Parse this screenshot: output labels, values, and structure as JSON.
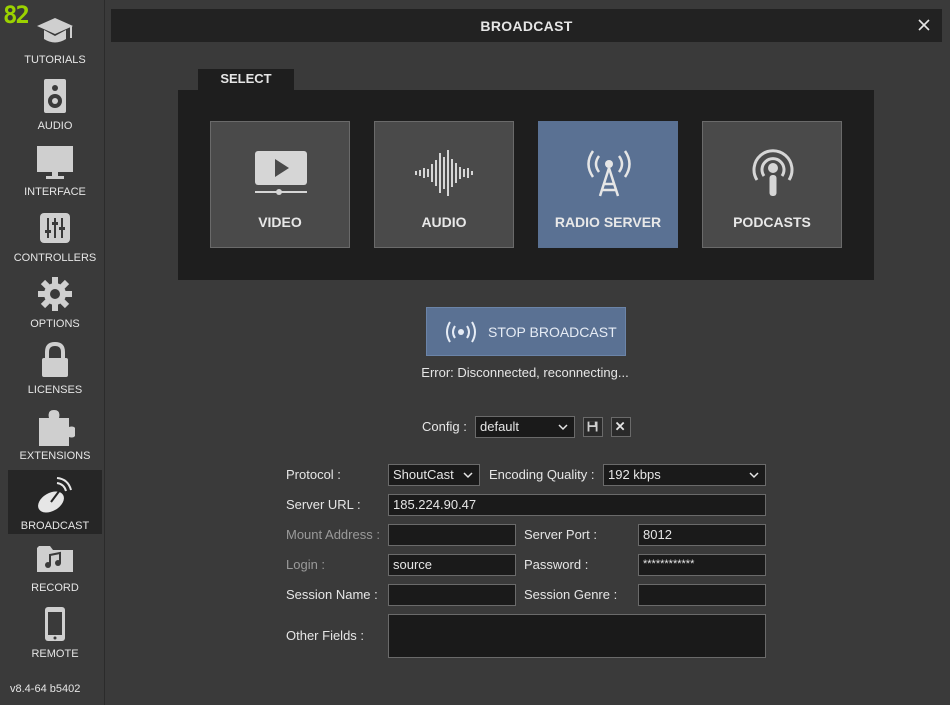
{
  "logo": "82",
  "sidebar": {
    "items": [
      {
        "label": "TUTORIALS",
        "icon": "graduation-cap-icon"
      },
      {
        "label": "AUDIO",
        "icon": "speaker-icon"
      },
      {
        "label": "INTERFACE",
        "icon": "monitor-icon"
      },
      {
        "label": "CONTROLLERS",
        "icon": "sliders-icon"
      },
      {
        "label": "OPTIONS",
        "icon": "gear-icon"
      },
      {
        "label": "LICENSES",
        "icon": "lock-icon"
      },
      {
        "label": "EXTENSIONS",
        "icon": "puzzle-icon"
      },
      {
        "label": "BROADCAST",
        "icon": "satellite-dish-icon",
        "active": true
      },
      {
        "label": "RECORD",
        "icon": "music-folder-icon"
      },
      {
        "label": "REMOTE",
        "icon": "phone-icon"
      }
    ],
    "version": "v8.4-64 b5402"
  },
  "window": {
    "title": "BROADCAST",
    "close_icon": "close-icon"
  },
  "select": {
    "tab_label": "SELECT",
    "cards": [
      {
        "label": "VIDEO",
        "icon": "video-play-icon"
      },
      {
        "label": "AUDIO",
        "icon": "audio-waveform-icon"
      },
      {
        "label": "RADIO SERVER",
        "icon": "radio-tower-icon",
        "active": true
      },
      {
        "label": "PODCASTS",
        "icon": "podcast-icon"
      }
    ]
  },
  "broadcast": {
    "stop_label": "STOP BROADCAST",
    "error_text": "Error: Disconnected, reconnecting..."
  },
  "config": {
    "label": "Config :",
    "value": "default"
  },
  "form": {
    "protocol_label": "Protocol :",
    "protocol_value": "ShoutCast",
    "encoding_label": "Encoding Quality :",
    "encoding_value": "192 kbps",
    "server_url_label": "Server URL :",
    "server_url_value": "185.224.90.47",
    "mount_label": "Mount Address :",
    "mount_value": "",
    "port_label": "Server Port :",
    "port_value": "8012",
    "login_label": "Login :",
    "login_value": "source",
    "password_label": "Password :",
    "password_value": "************",
    "session_name_label": "Session Name :",
    "session_name_value": "",
    "session_genre_label": "Session Genre :",
    "session_genre_value": "",
    "other_fields_label": "Other Fields :",
    "other_fields_value": ""
  },
  "colors": {
    "accent": "#5a7193",
    "logo": "#9bd200",
    "panel": "#1e1e1e",
    "background": "#3a3a3a"
  }
}
